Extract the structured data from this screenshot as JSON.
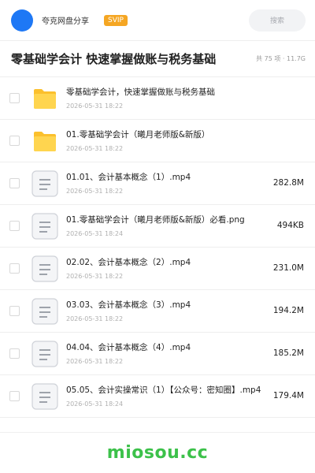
{
  "header": {
    "brand": "夸克网盘分享",
    "badge": "SVIP",
    "search_placeholder": "搜索"
  },
  "folder": {
    "title": "零基础学会计 快速掌握做账与税务基础",
    "meta": "共 75 项 · 11.7G"
  },
  "files": [
    {
      "name": "零基础学会计，快速掌握做账与税务基础",
      "date": "2026-05-31 18:22",
      "size": "",
      "icon": "folder-icon"
    },
    {
      "name": "01.零基础学会计（曦月老师版&新版）",
      "date": "2026-05-31 18:22",
      "size": "",
      "icon": "folder-icon"
    },
    {
      "name": "01.01、会计基本概念（1）.mp4",
      "date": "2026-05-31 18:22",
      "size": "282.8M",
      "icon": "document-icon"
    },
    {
      "name": "01.零基础学会计（曦月老师版&新版）必看.png",
      "date": "2026-05-31 18:24",
      "size": "494KB",
      "icon": "document-icon"
    },
    {
      "name": "02.02、会计基本概念（2）.mp4",
      "date": "2026-05-31 18:22",
      "size": "231.0M",
      "icon": "document-icon"
    },
    {
      "name": "03.03、会计基本概念（3）.mp4",
      "date": "2026-05-31 18:22",
      "size": "194.2M",
      "icon": "document-icon"
    },
    {
      "name": "04.04、会计基本概念（4）.mp4",
      "date": "2026-05-31 18:22",
      "size": "185.2M",
      "icon": "document-icon"
    },
    {
      "name": "05.05、会计实操常识（1）【公众号：密知圈】.mp4",
      "date": "2026-05-31 18:24",
      "size": "179.4M",
      "icon": "document-icon"
    }
  ],
  "footer": {
    "watermark": "miosou.cc"
  },
  "colors": {
    "avatar": "#1e78f5",
    "badge": "#f5a623",
    "folder": "#fbc02d",
    "watermark": "#3cc14a"
  }
}
